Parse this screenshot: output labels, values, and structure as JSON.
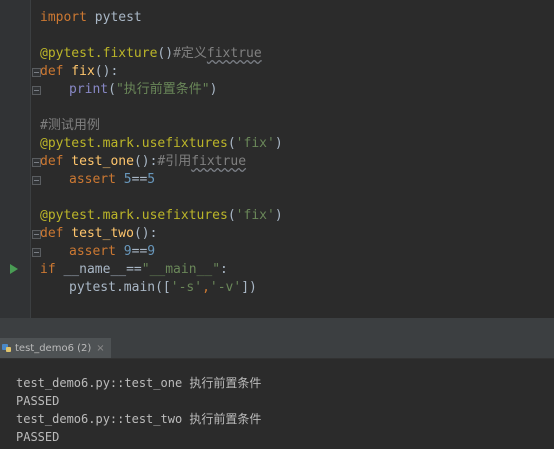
{
  "code": {
    "line1_kw": "import",
    "line1_rest": " pytest",
    "line3_deco": "@pytest.fixture",
    "line3_paren": "()",
    "line3_comment": "#定义",
    "line3_comment_word": "fixtrue",
    "line4_kw": "def",
    "line4_fn": " fix",
    "line4_rest": "():",
    "line5_builtin": "print",
    "line5_open": "(",
    "line5_str": "\"执行前置条件\"",
    "line5_close": ")",
    "line7_comment": "#测试用例",
    "line8_deco": "@pytest.mark.usefixtures",
    "line8_open": "(",
    "line8_str": "'fix'",
    "line8_close": ")",
    "line9_kw": "def",
    "line9_fn": " test_one",
    "line9_rest": "():",
    "line9_comment": "#引用",
    "line9_comment_word": "fixtrue",
    "line10_kw": "assert",
    "line10_num1": " 5",
    "line10_op": "==",
    "line10_num2": "5",
    "line12_deco": "@pytest.mark.usefixtures",
    "line12_open": "(",
    "line12_str": "'fix'",
    "line12_close": ")",
    "line13_kw": "def",
    "line13_fn": " test_two",
    "line13_rest": "():",
    "line14_kw": "assert",
    "line14_num1": " 9",
    "line14_op": "==",
    "line14_num2": "9",
    "line15_kw": "if",
    "line15_rest": " __name__==",
    "line15_str": "\"__main__\"",
    "line15_colon": ":",
    "line16_pre": "pytest.main([",
    "line16_str1": "'-s'",
    "line16_comma": ",",
    "line16_str2": "'-v'",
    "line16_post": "])"
  },
  "run_tab": {
    "label": "test_demo6 (2)",
    "close": "×"
  },
  "console": {
    "lines": [
      "test_demo6.py::test_one 执行前置条件",
      "PASSED",
      "test_demo6.py::test_two 执行前置条件",
      "PASSED"
    ]
  },
  "icons": {
    "run_gutter": "run-triangle-icon",
    "tab": "python-file-icon"
  },
  "colors": {
    "keyword": "#cc7832",
    "decorator": "#bbb529",
    "function": "#ffc66d",
    "string": "#6a8759",
    "number": "#6897bb",
    "comment": "#808080",
    "builtin": "#8888c6",
    "run_icon": "#499c54"
  }
}
